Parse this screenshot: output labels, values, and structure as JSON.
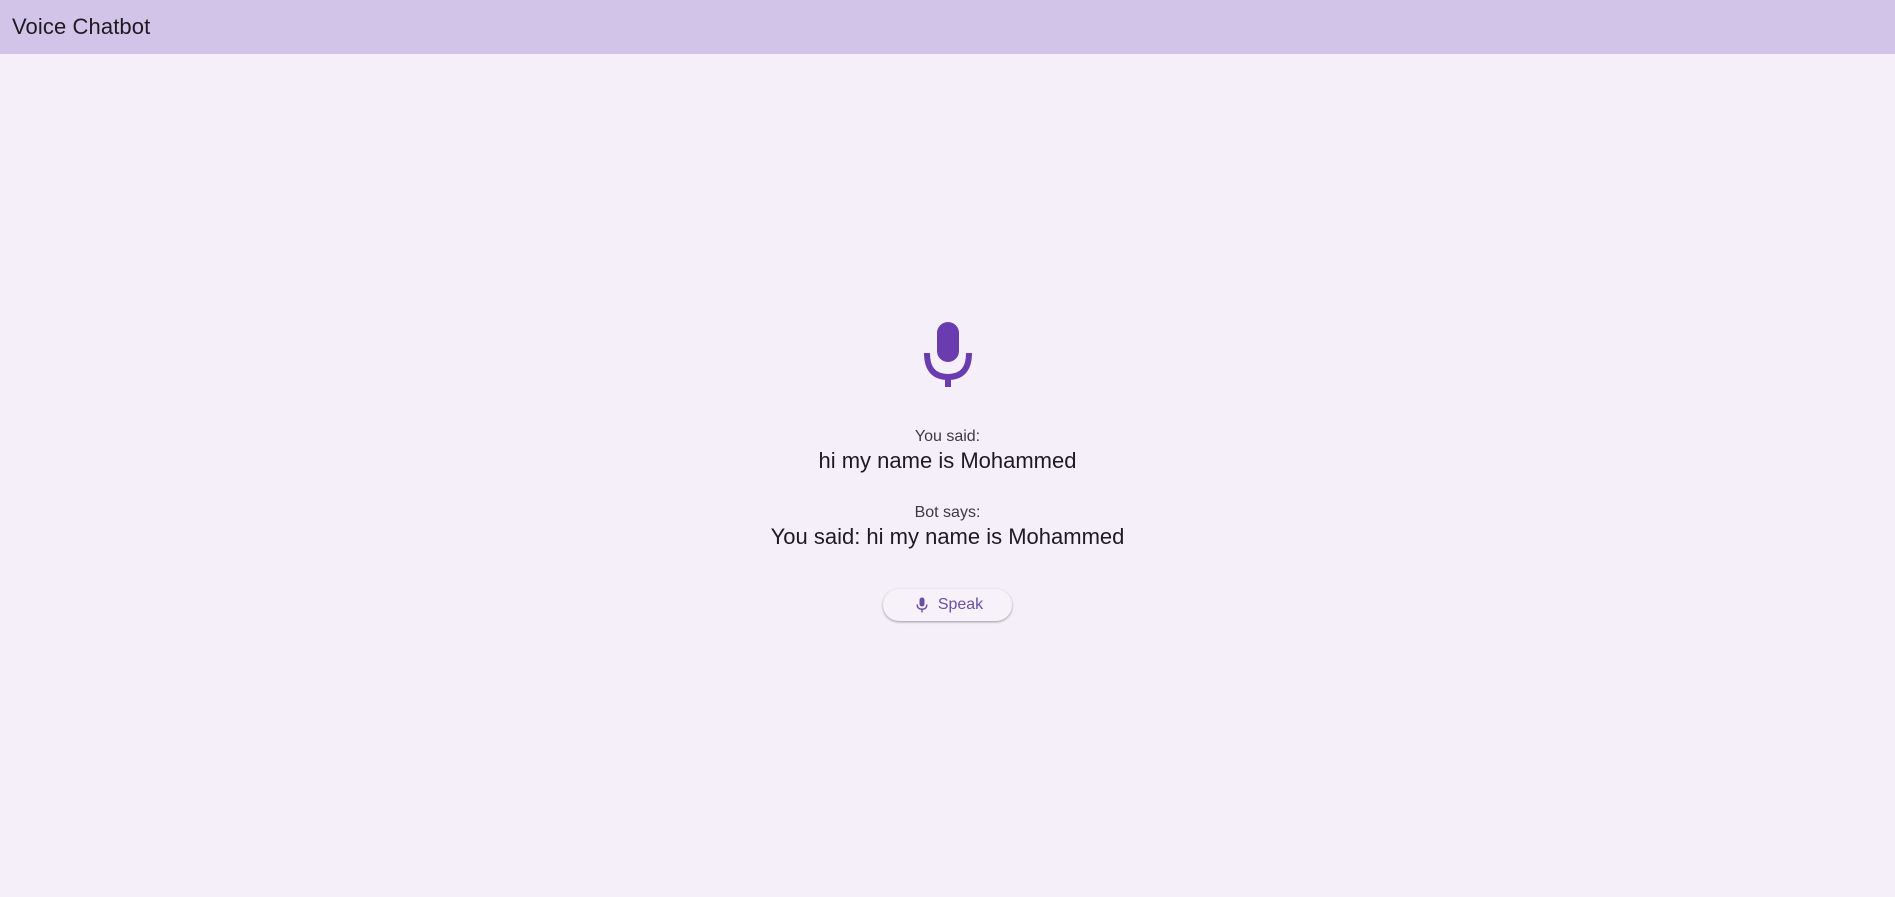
{
  "app_bar": {
    "title": "Voice Chatbot"
  },
  "main": {
    "mic_icon": "microphone-icon",
    "user_label": "You said:",
    "user_text": "hi my name is Mohammed",
    "bot_label": "Bot says:",
    "bot_text": "You said: hi my name is Mohammed",
    "speak_button": {
      "icon": "microphone-icon",
      "label": "Speak"
    }
  },
  "colors": {
    "app_bar_bg": "#d2c4e9",
    "page_bg": "#f4eff9",
    "accent": "#6750a4",
    "mic_big": "#6a3cb0"
  }
}
